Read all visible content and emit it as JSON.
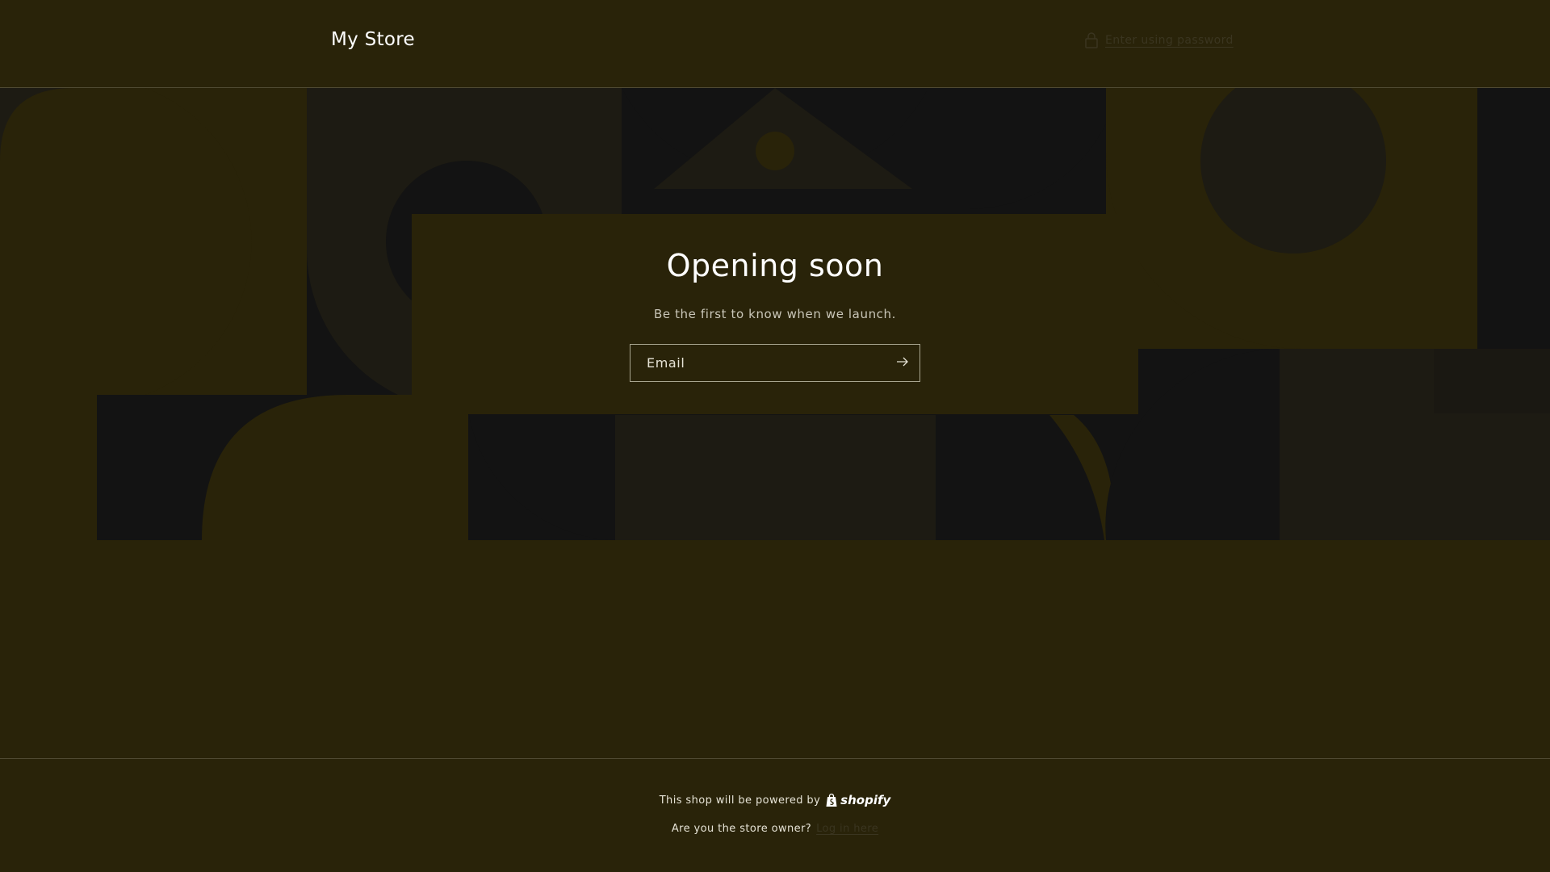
{
  "header": {
    "store_name": "My Store",
    "password_link": {
      "label": "Enter using password",
      "icon": "lock-icon"
    }
  },
  "hero": {
    "title": "Opening soon",
    "subtitle": "Be the first to know when we launch.",
    "email_field": {
      "placeholder": "Email",
      "value": ""
    },
    "submit_icon": "arrow-right-icon"
  },
  "footer": {
    "powered_by": "This shop will be powered by",
    "brand": "shopify",
    "owner_question": "Are you the store owner?",
    "login_link": "Log in here"
  },
  "colors": {
    "background": "#292309",
    "banner_dark": "#131313",
    "text": "#ffffff",
    "muted_link": "#3a3520"
  }
}
